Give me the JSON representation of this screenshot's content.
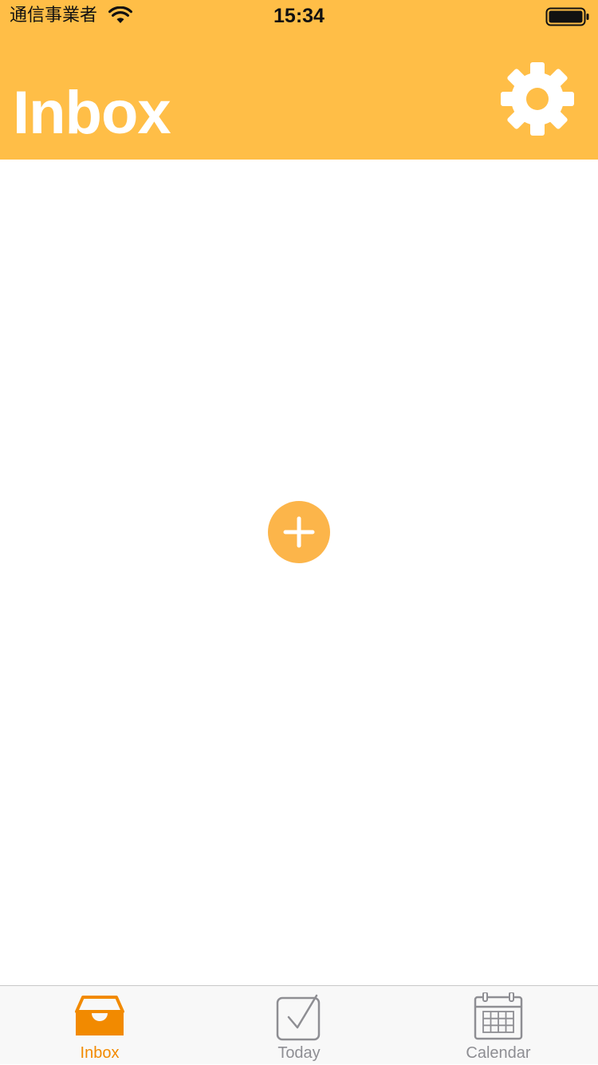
{
  "status_bar": {
    "carrier": "通信事業者",
    "time": "15:34",
    "wifi_icon": "wifi-icon",
    "battery_icon": "battery-full-icon"
  },
  "header": {
    "title": "Inbox",
    "settings_icon": "gear-icon",
    "background_color": "#FFBE47"
  },
  "main": {
    "add_icon": "plus-icon",
    "add_button_color": "#FCB54A"
  },
  "tab_bar": {
    "active_color": "#F28A00",
    "inactive_color": "#8E8E93",
    "tabs": [
      {
        "label": "Inbox",
        "icon": "inbox-tray-icon",
        "selected": true
      },
      {
        "label": "Today",
        "icon": "checkbox-icon",
        "selected": false
      },
      {
        "label": "Calendar",
        "icon": "calendar-icon",
        "selected": false
      }
    ]
  }
}
